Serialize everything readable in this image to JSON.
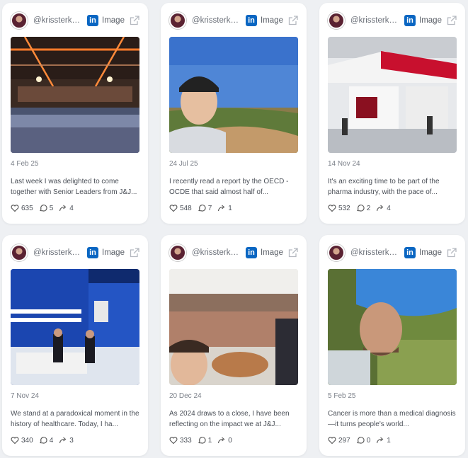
{
  "cards": [
    {
      "handle": "@krissterke...",
      "platform": "LinkedIn",
      "type": "Image",
      "date": "4 Feb 25",
      "text": "Last week I was delighted to come together with Senior Leaders from J&J...",
      "likes": "635",
      "comments": "5",
      "shares": "4",
      "image": "conference-hall-crowd"
    },
    {
      "handle": "@krissterke...",
      "platform": "LinkedIn",
      "type": "Image",
      "date": "24 Jul 25",
      "text": "I recently read a report by the OECD - OCDE that said almost half of...",
      "likes": "548",
      "comments": "7",
      "shares": "1",
      "image": "cyclist-selfie-vineyard"
    },
    {
      "handle": "@krissterke...",
      "platform": "LinkedIn",
      "type": "Image",
      "date": "14 Nov 24",
      "text": "It's an exciting time to be part of the pharma industry, with the pace of...",
      "likes": "532",
      "comments": "2",
      "shares": "4",
      "image": "exhibition-booth"
    },
    {
      "handle": "@krissterke...",
      "platform": "LinkedIn",
      "type": "Image",
      "date": "7 Nov 24",
      "text": "We stand at a paradoxical moment in the history of healthcare.   Today, I ha...",
      "likes": "340",
      "comments": "4",
      "shares": "3",
      "image": "biotech-summit-stage"
    },
    {
      "handle": "@krissterke...",
      "platform": "LinkedIn",
      "type": "Image",
      "date": "20 Dec 24",
      "text": "As 2024 draws to a close, I have been reflecting on the impact we at J&J...",
      "likes": "333",
      "comments": "1",
      "shares": "0",
      "image": "office-group-selfie"
    },
    {
      "handle": "@krissterke...",
      "platform": "LinkedIn",
      "type": "Image",
      "date": "5 Feb 25",
      "text": "Cancer is more than a medical diagnosis—it turns people's world...",
      "likes": "297",
      "comments": "0",
      "shares": "1",
      "image": "upside-down-portrait"
    }
  ],
  "colors": {
    "linkedin": "#0a66c2",
    "card_bg": "#ffffff",
    "page_bg": "#eef0f3"
  }
}
